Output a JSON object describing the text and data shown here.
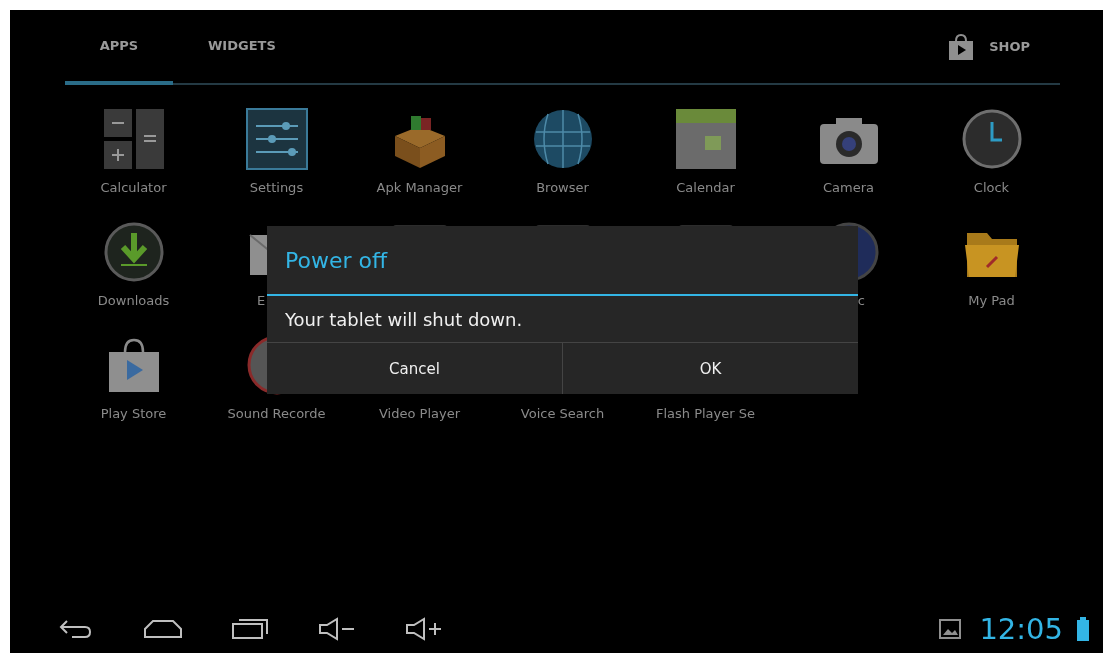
{
  "tabs": [
    {
      "label": "APPS",
      "selected": true
    },
    {
      "label": "WIDGETS",
      "selected": false
    }
  ],
  "shop": {
    "label": "SHOP"
  },
  "apps": [
    {
      "label": "Calculator",
      "kind": "calculator"
    },
    {
      "label": "Settings",
      "kind": "settings"
    },
    {
      "label": "Apk Manager",
      "kind": "box"
    },
    {
      "label": "Browser",
      "kind": "globe"
    },
    {
      "label": "Calendar",
      "kind": "calendar"
    },
    {
      "label": "Camera",
      "kind": "camera"
    },
    {
      "label": "Clock",
      "kind": "clock"
    },
    {
      "label": "Downloads",
      "kind": "download"
    },
    {
      "label": "E",
      "kind": "mail",
      "covered_right": true
    },
    {
      "kind": "tile"
    },
    {
      "kind": "tile"
    },
    {
      "kind": "tile"
    },
    {
      "label": "c",
      "kind": "disc",
      "covered_left": true
    },
    {
      "label": "My Pad",
      "kind": "folder"
    },
    {
      "label": "Play Store",
      "kind": "store"
    },
    {
      "label": "Sound Recorde",
      "kind": "record"
    },
    {
      "label": "Video Player"
    },
    {
      "label": "Voice Search"
    },
    {
      "label": "Flash Player Se"
    }
  ],
  "dialog": {
    "title": "Power off",
    "message": "Your tablet will shut down.",
    "buttons": [
      "Cancel",
      "OK"
    ]
  },
  "status": {
    "time": "12:05"
  }
}
